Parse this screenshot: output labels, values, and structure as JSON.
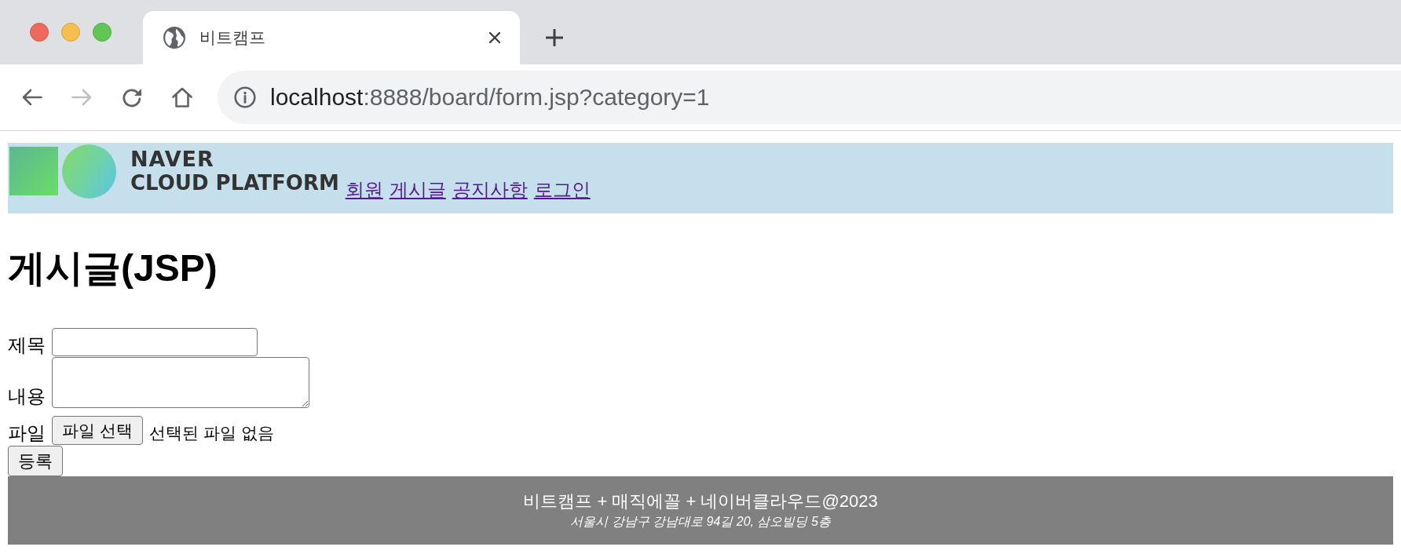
{
  "tabs": [
    {
      "title": "비트캠프",
      "selected": true
    }
  ],
  "toolbar": {
    "buttons": [
      {
        "kind": "back",
        "disabled": false
      },
      {
        "kind": "forward",
        "disabled": true
      },
      {
        "kind": "reload",
        "disabled": false
      },
      {
        "kind": "home",
        "disabled": false
      }
    ]
  },
  "address_bar": {
    "host": "localhost",
    "path": ":8888/board/form.jsp?category=1"
  },
  "header": {
    "logo": {
      "line_1": "NAVER",
      "line_2": "CLOUD PLATFORM"
    },
    "nav": [
      {
        "label": "회원"
      },
      {
        "label": "게시글"
      },
      {
        "label": "공지사항"
      },
      {
        "label": "로그인"
      }
    ]
  },
  "heading": "게시글(JSP)",
  "form": {
    "fields": [
      {
        "kind": "text",
        "label": "제목"
      },
      {
        "kind": "textarea",
        "label": "내용"
      },
      {
        "kind": "file",
        "label": "파일",
        "button": "파일 선택",
        "status": "선택된 파일 없음"
      }
    ],
    "submit": "등록"
  },
  "footer": {
    "line_1": "비트캠프 + 매직에꼴 + 네이버클라우드@2023",
    "line_2": "서울시 강남구 강남대로 94길 20, 삼오빌딩 5층"
  }
}
